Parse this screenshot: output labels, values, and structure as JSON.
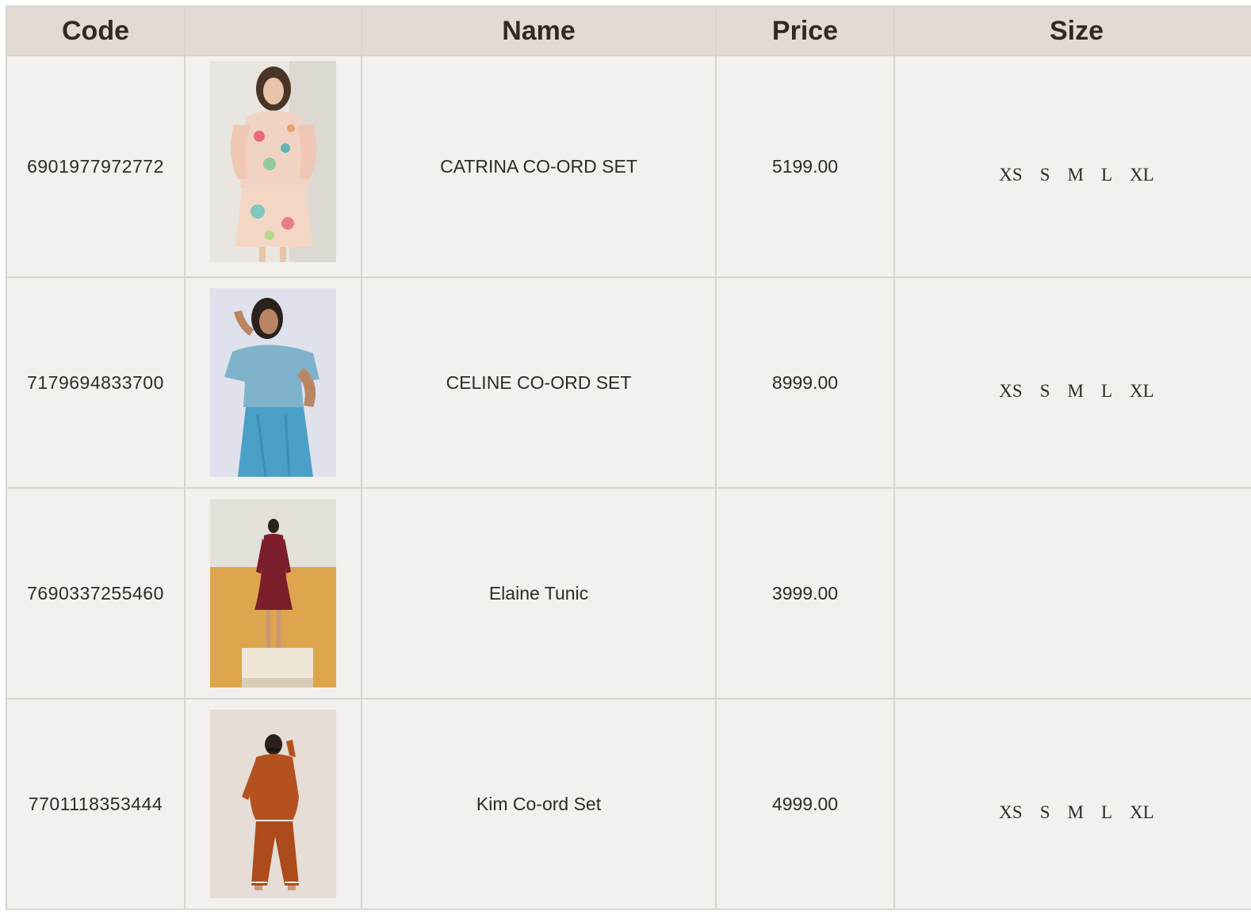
{
  "table": {
    "headers": {
      "code": "Code",
      "image": "",
      "name": "Name",
      "price": "Price",
      "size": "Size"
    },
    "rows": [
      {
        "code": "6901977972772",
        "image_icon": "product-photo-floral-dress",
        "name": "CATRINA CO-ORD SET",
        "price": "5199.00",
        "sizes": [
          "XS",
          "S",
          "M",
          "L",
          "XL"
        ]
      },
      {
        "code": "7179694833700",
        "image_icon": "product-photo-blue-set",
        "name": "CELINE CO-ORD SET",
        "price": "8999.00",
        "sizes": [
          "XS",
          "S",
          "M",
          "L",
          "XL"
        ]
      },
      {
        "code": "7690337255460",
        "image_icon": "product-photo-maroon-tunic",
        "name": "Elaine Tunic",
        "price": "3999.00",
        "sizes": []
      },
      {
        "code": "7701118353444",
        "image_icon": "product-photo-rust-set",
        "name": "Kim Co-ord Set",
        "price": "4999.00",
        "sizes": [
          "XS",
          "S",
          "M",
          "L",
          "XL"
        ]
      }
    ]
  },
  "colors": {
    "header_bg": "#e2dbd3",
    "row_bg": "#f2f1ee",
    "border": "#d8d5cf",
    "text": "#2f2a26"
  }
}
